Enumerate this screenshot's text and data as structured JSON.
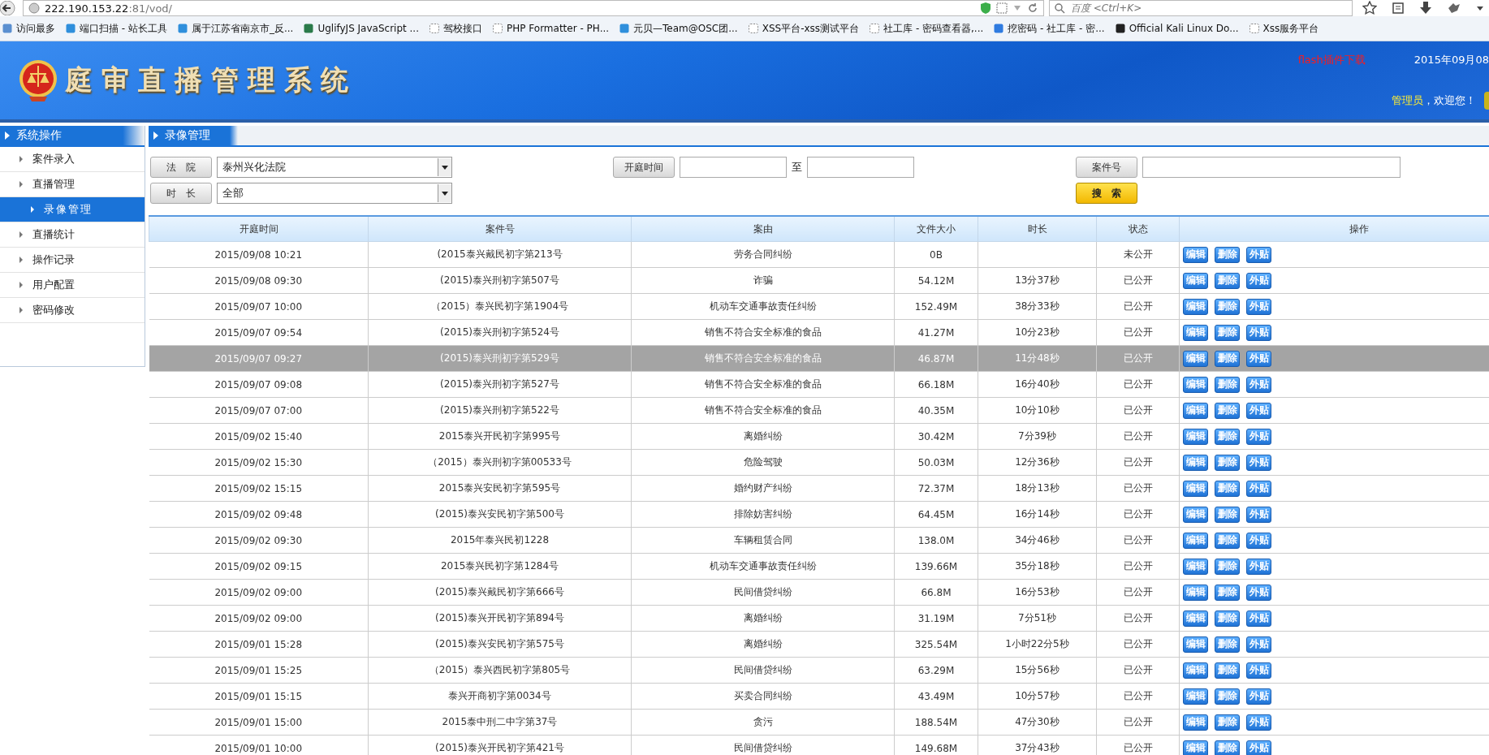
{
  "browser": {
    "url_host": "222.190.153.22",
    "url_rest": ":81/vod/",
    "search_placeholder": "百度 <Ctrl+K>",
    "bookmarks": [
      {
        "label": "访问最多",
        "kind": "folder"
      },
      {
        "label": "端口扫描 - 站长工具",
        "kind": "site"
      },
      {
        "label": "属于江苏省南京市_反...",
        "kind": "site"
      },
      {
        "label": "UglifyJS JavaScript ...",
        "kind": "owl"
      },
      {
        "label": "驾校接口",
        "kind": "blank"
      },
      {
        "label": "PHP Formatter - PH...",
        "kind": "blank"
      },
      {
        "label": "元贝—Team@OSC团...",
        "kind": "site"
      },
      {
        "label": "XSS平台-xss测试平台",
        "kind": "blank"
      },
      {
        "label": "社工库 - 密码查看器,...",
        "kind": "blank"
      },
      {
        "label": "挖密码 - 社工库 - 密...",
        "kind": "shield"
      },
      {
        "label": "Official Kali Linux Do...",
        "kind": "kali"
      },
      {
        "label": "Xss服务平台",
        "kind": "blank"
      }
    ]
  },
  "header": {
    "title": "庭审直播管理系统",
    "flash_link": "flash插件下载",
    "date": "2015年09月08",
    "user": "管理员",
    "welcome": "，欢迎您！"
  },
  "sidebar": {
    "title": "系统操作",
    "items": [
      {
        "label": "案件录入",
        "selected": false
      },
      {
        "label": "直播管理",
        "selected": false
      },
      {
        "label": "录像管理",
        "selected": true
      },
      {
        "label": "直播统计",
        "selected": false
      },
      {
        "label": "操作记录",
        "selected": false
      },
      {
        "label": "用户配置",
        "selected": false
      },
      {
        "label": "密码修改",
        "selected": false
      }
    ]
  },
  "main": {
    "title": "录像管理",
    "filters": {
      "court_label": "法　院",
      "court_value": "泰州兴化法院",
      "duration_label": "时　长",
      "duration_value": "全部",
      "time_label": "开庭时间",
      "to": "至",
      "case_label": "案件号",
      "search_button": "搜　索"
    },
    "table": {
      "columns": [
        "开庭时间",
        "案件号",
        "案由",
        "文件大小",
        "时长",
        "状态",
        "操作"
      ],
      "rows": [
        {
          "time": "2015/09/08 10:21",
          "case": "(2015泰兴戴民初字第213号",
          "cause": "劳务合同纠纷",
          "size": "0B",
          "status": "未公开",
          "selected": false,
          "actions": [
            "编辑",
            "删除",
            "外贴"
          ]
        },
        {
          "time": "2015/09/08 09:30",
          "case": "(2015)泰兴刑初字第507号",
          "cause": "诈骗",
          "size": "54.12M",
          "duration": "13分37秒",
          "status": "已公开",
          "selected": false,
          "actions": [
            "编辑",
            "删除",
            "外贴"
          ]
        },
        {
          "time": "2015/09/07 10:00",
          "case": "（2015）泰兴民初字第1904号",
          "cause": "机动车交通事故责任纠纷",
          "size": "152.49M",
          "duration": "38分33秒",
          "status": "已公开",
          "selected": false,
          "actions": [
            "编辑",
            "删除",
            "外贴"
          ]
        },
        {
          "time": "2015/09/07 09:54",
          "case": "(2015)泰兴刑初字第524号",
          "cause": "销售不符合安全标准的食品",
          "size": "41.27M",
          "duration": "10分23秒",
          "status": "已公开",
          "selected": false,
          "actions": [
            "编辑",
            "删除",
            "外贴"
          ]
        },
        {
          "time": "2015/09/07 09:27",
          "case": "(2015)泰兴刑初字第529号",
          "cause": "销售不符合安全标准的食品",
          "size": "46.87M",
          "duration": "11分48秒",
          "status": "已公开",
          "selected": true,
          "actions": [
            "编辑",
            "删除",
            "外贴"
          ]
        },
        {
          "time": "2015/09/07 09:08",
          "case": "(2015)泰兴刑初字第527号",
          "cause": "销售不符合安全标准的食品",
          "size": "66.18M",
          "duration": "16分40秒",
          "status": "已公开",
          "selected": false,
          "actions": [
            "编辑",
            "删除",
            "外贴"
          ]
        },
        {
          "time": "2015/09/07 07:00",
          "case": "(2015)泰兴刑初字第522号",
          "cause": "销售不符合安全标准的食品",
          "size": "40.35M",
          "duration": "10分10秒",
          "status": "已公开",
          "selected": false,
          "actions": [
            "编辑",
            "删除",
            "外贴"
          ]
        },
        {
          "time": "2015/09/02 15:40",
          "case": "2015泰兴开民初字第995号",
          "cause": "离婚纠纷",
          "size": "30.42M",
          "duration": "7分39秒",
          "status": "已公开",
          "selected": false,
          "actions": [
            "编辑",
            "删除",
            "外贴"
          ]
        },
        {
          "time": "2015/09/02 15:30",
          "case": "（2015）泰兴刑初字第00533号",
          "cause": "危险驾驶",
          "size": "50.03M",
          "duration": "12分36秒",
          "status": "已公开",
          "selected": false,
          "actions": [
            "编辑",
            "删除",
            "外贴"
          ]
        },
        {
          "time": "2015/09/02 15:15",
          "case": "2015泰兴安民初字第595号",
          "cause": "婚约财产纠纷",
          "size": "72.37M",
          "duration": "18分13秒",
          "status": "已公开",
          "selected": false,
          "actions": [
            "编辑",
            "删除",
            "外贴"
          ]
        },
        {
          "time": "2015/09/02 09:48",
          "case": "(2015)泰兴安民初字第500号",
          "cause": "排除妨害纠纷",
          "size": "64.45M",
          "duration": "16分14秒",
          "status": "已公开",
          "selected": false,
          "actions": [
            "编辑",
            "删除",
            "外贴"
          ]
        },
        {
          "time": "2015/09/02 09:30",
          "case": "2015年泰兴民初1228",
          "cause": "车辆租赁合同",
          "size": "138.0M",
          "duration": "34分46秒",
          "status": "已公开",
          "selected": false,
          "actions": [
            "编辑",
            "删除",
            "外贴"
          ]
        },
        {
          "time": "2015/09/02 09:15",
          "case": "2015泰兴民初字第1284号",
          "cause": "机动车交通事故责任纠纷",
          "size": "139.66M",
          "duration": "35分18秒",
          "status": "已公开",
          "selected": false,
          "actions": [
            "编辑",
            "删除",
            "外贴"
          ]
        },
        {
          "time": "2015/09/02 09:00",
          "case": "(2015)泰兴戴民初字第666号",
          "cause": "民间借贷纠纷",
          "size": "66.8M",
          "duration": "16分53秒",
          "status": "已公开",
          "selected": false,
          "actions": [
            "编辑",
            "删除",
            "外贴"
          ]
        },
        {
          "time": "2015/09/02 09:00",
          "case": "(2015)泰兴开民初字第894号",
          "cause": "离婚纠纷",
          "size": "31.19M",
          "duration": "7分51秒",
          "status": "已公开",
          "selected": false,
          "actions": [
            "编辑",
            "删除",
            "外贴"
          ]
        },
        {
          "time": "2015/09/01 15:28",
          "case": "(2015)泰兴安民初字第575号",
          "cause": "离婚纠纷",
          "size": "325.54M",
          "duration": "1小时22分5秒",
          "status": "已公开",
          "selected": false,
          "actions": [
            "编辑",
            "删除",
            "外贴"
          ]
        },
        {
          "time": "2015/09/01 15:25",
          "case": "（2015）泰兴西民初字第805号",
          "cause": "民间借贷纠纷",
          "size": "63.29M",
          "duration": "15分56秒",
          "status": "已公开",
          "selected": false,
          "actions": [
            "编辑",
            "删除",
            "外贴"
          ]
        },
        {
          "time": "2015/09/01 15:15",
          "case": "泰兴开商初字第0034号",
          "cause": "买卖合同纠纷",
          "size": "43.49M",
          "duration": "10分57秒",
          "status": "已公开",
          "selected": false,
          "actions": [
            "编辑",
            "删除",
            "外贴"
          ]
        },
        {
          "time": "2015/09/01 15:00",
          "case": "2015泰中刑二中字第37号",
          "cause": "贪污",
          "size": "188.54M",
          "duration": "47分30秒",
          "status": "已公开",
          "selected": false,
          "actions": [
            "编辑",
            "删除",
            "外贴"
          ]
        },
        {
          "time": "2015/09/01 10:00",
          "case": "(2015)泰兴开民初字第421号",
          "cause": "民间借贷纠纷",
          "size": "149.68M",
          "duration": "37分43秒",
          "status": "已公开",
          "selected": false,
          "actions": [
            "编辑",
            "删除",
            "外贴"
          ]
        }
      ]
    }
  }
}
